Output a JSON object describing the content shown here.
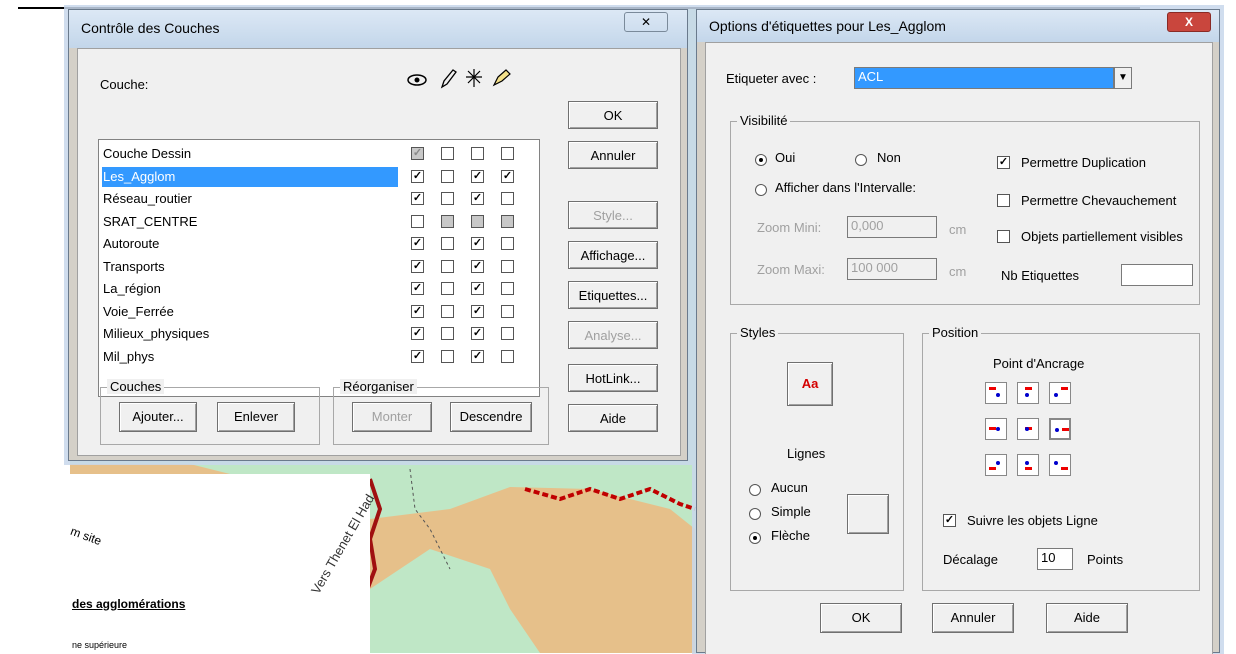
{
  "layer_control": {
    "title": "Contrôle des Couches",
    "close": "✕",
    "column_header": "Couche:",
    "col_icons": [
      "eye-icon",
      "pencil-icon",
      "select-icon",
      "label-icon"
    ],
    "layers": [
      {
        "name": "Couche Dessin",
        "flags": [
          "g",
          "",
          "",
          ""
        ]
      },
      {
        "name": "Les_Agglom",
        "flags": [
          "x",
          "",
          "x",
          "x"
        ]
      },
      {
        "name": "Réseau_routier",
        "flags": [
          "x",
          "",
          "x",
          ""
        ]
      },
      {
        "name": "SRAT_CENTRE",
        "flags": [
          "",
          "g",
          "g",
          "g"
        ]
      },
      {
        "name": "Autoroute",
        "flags": [
          "x",
          "",
          "x",
          ""
        ]
      },
      {
        "name": "Transports",
        "flags": [
          "x",
          "",
          "x",
          ""
        ]
      },
      {
        "name": "La_région",
        "flags": [
          "x",
          "",
          "x",
          ""
        ]
      },
      {
        "name": "Voie_Ferrée",
        "flags": [
          "x",
          "",
          "x",
          ""
        ]
      },
      {
        "name": "Milieux_physiques",
        "flags": [
          "x",
          "",
          "x",
          ""
        ]
      },
      {
        "name": "Mil_phys",
        "flags": [
          "x",
          "",
          "x",
          ""
        ]
      }
    ],
    "buttons": {
      "ok": "OK",
      "cancel": "Annuler",
      "style": "Style...",
      "display": "Affichage...",
      "labels": "Etiquettes...",
      "analysis": "Analyse...",
      "hotlink": "HotLink...",
      "help": "Aide"
    },
    "layers_group": {
      "title": "Couches",
      "add": "Ajouter...",
      "remove": "Enlever"
    },
    "reorder_group": {
      "title": "Réorganiser",
      "up": "Monter",
      "down": "Descendre"
    }
  },
  "label_options": {
    "title": "Options d'étiquettes pour Les_Agglom",
    "close": "X",
    "label_with": "Etiqueter avec :",
    "label_field": "ACL",
    "visibility": {
      "title": "Visibilité",
      "yes": "Oui",
      "no": "Non",
      "range": "Afficher dans l'Intervalle:",
      "zoom_min_label": "Zoom Mini:",
      "zoom_min": "0,000",
      "zoom_max_label": "Zoom Maxi:",
      "zoom_max": "100 000",
      "unit": "cm",
      "allow_dup": "Permettre Duplication",
      "allow_overlap": "Permettre Chevauchement",
      "partial": "Objets partiellement visibles",
      "nb_labels": "Nb Etiquettes",
      "nb_value": ""
    },
    "styles": {
      "title": "Styles",
      "aa": "Aa",
      "lines": "Lignes",
      "none": "Aucun",
      "simple": "Simple",
      "arrow": "Flèche"
    },
    "position": {
      "title": "Position",
      "anchor": "Point d'Ancrage",
      "follow": "Suivre les objets Ligne",
      "offset_label": "Décalage",
      "offset": "10",
      "points": "Points"
    },
    "buttons": {
      "ok": "OK",
      "cancel": "Annuler",
      "help": "Aide"
    }
  },
  "map": {
    "legend": "des agglomérations",
    "legend2": "ne supérieure",
    "road_text": "Vers Thenet El Had",
    "road_text2": "m site"
  }
}
